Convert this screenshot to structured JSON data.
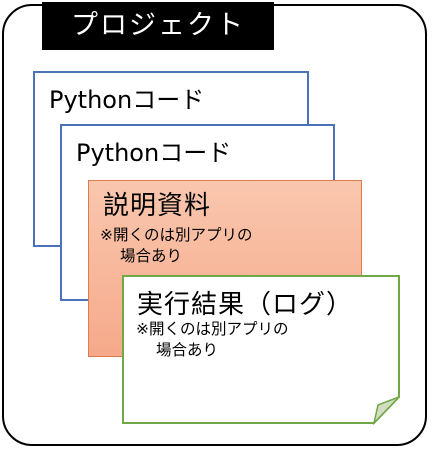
{
  "project": {
    "title": "プロジェクト"
  },
  "documents": {
    "python_1": {
      "label": "Pythonコード"
    },
    "python_2": {
      "label": "Pythonコード"
    },
    "explanation": {
      "label": "説明資料",
      "note_line1": "※開くのは別アプリの",
      "note_line2": "場合あり"
    },
    "result": {
      "label": "実行結果（ログ）",
      "note_line1": "※開くのは別アプリの",
      "note_line2": "場合あり"
    }
  },
  "colors": {
    "frame": "#000000",
    "python_border": "#4a72b8",
    "explanation_fill": "#f6a98a",
    "explanation_border": "#e07b4c",
    "result_border": "#70a845",
    "result_fold": "#d3ddc4"
  }
}
